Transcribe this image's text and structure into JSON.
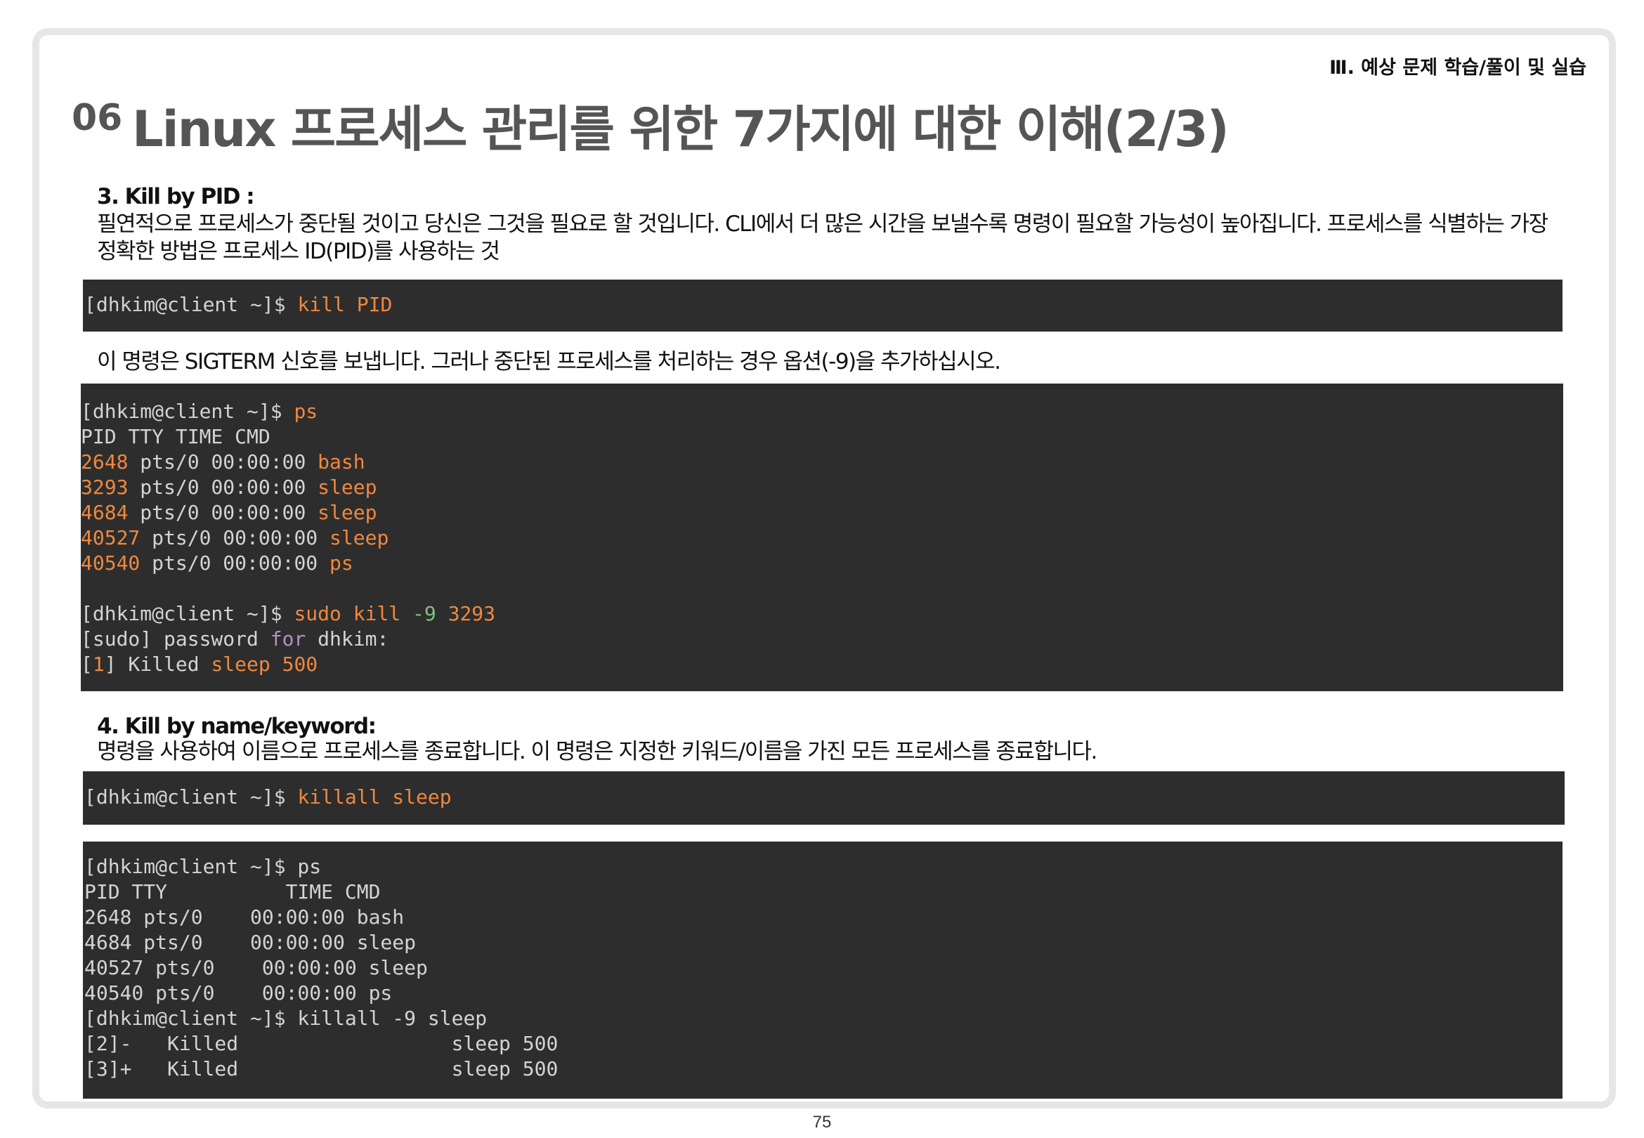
{
  "header": {
    "section_label": "Ⅲ. 예상 문제 학습/풀이 및 실습",
    "title_number": "06",
    "title": "Linux 프로세스 관리를 위한 7가지에 대한 이해(2/3)"
  },
  "kill_by_pid": {
    "heading": "3. Kill by PID :",
    "description": "필연적으로 프로세스가 중단될 것이고 당신은 그것을 필요로 할 것입니다. CLI에서 더 많은 시간을 보낼수록 명령이 필요할 가능성이 높아집니다. 프로세스를 식별하는 가장 정확한 방법은 프로세스 ID(PID)를 사용하는 것",
    "terminal1": {
      "prompt": "[dhkim@client ~]$ ",
      "command": "kill PID"
    },
    "note": "이 명령은 SIGTERM 신호를 보냅니다. 그러나 중단된 프로세스를 처리하는 경우 옵션(-9)을 추가하십시오.",
    "terminal2": {
      "prompt": "[dhkim@client ~]$ ",
      "ps_command": "ps",
      "header": "PID TTY TIME CMD",
      "rows": [
        {
          "pid": "2648",
          "rest": " pts/0 00:00:00 ",
          "cmd": "bash"
        },
        {
          "pid": "3293",
          "rest": " pts/0 00:00:00 ",
          "cmd": "sleep"
        },
        {
          "pid": "4684",
          "rest": " pts/0 00:00:00 ",
          "cmd": "sleep"
        },
        {
          "pid": "40527",
          "rest": " pts/0 00:00:00 ",
          "cmd": "sleep"
        },
        {
          "pid": "40540",
          "rest": " pts/0 00:00:00 ",
          "cmd": "ps"
        }
      ],
      "kill_cmd": "sudo kill",
      "kill_flag": " -9",
      "kill_pid": " 3293",
      "sudo_prefix": "[sudo] password ",
      "sudo_for": "for",
      "sudo_user": " dhkim:",
      "killed_open": "[",
      "killed_num": "1",
      "killed_mid": "] Killed ",
      "killed_cmd": "sleep 500"
    }
  },
  "kill_by_name": {
    "heading": "4. Kill by name/keyword:",
    "description": "명령을 사용하여 이름으로 프로세스를 종료합니다. 이 명령은 지정한 키워드/이름을 가진 모든 프로세스를 종료합니다.",
    "terminal3": {
      "prompt": "[dhkim@client ~]$ ",
      "command": "killall sleep"
    },
    "terminal4": {
      "lines": [
        "[dhkim@client ~]$ ps",
        "PID TTY          TIME CMD",
        "2648 pts/0    00:00:00 bash",
        "4684 pts/0    00:00:00 sleep",
        "40527 pts/0    00:00:00 sleep",
        "40540 pts/0    00:00:00 ps",
        "[dhkim@client ~]$ killall -9 sleep",
        "[2]-   Killed                  sleep 500",
        "[3]+   Killed                  sleep 500"
      ]
    }
  },
  "footer": {
    "page_number": "75"
  },
  "colors": {
    "terminal_bg": "#2d2d2d",
    "terminal_text": "#d4d4d4",
    "accent_orange": "#f0883e",
    "accent_green": "#7ec27e",
    "accent_purple": "#b88ec9",
    "title_gray": "#555555"
  }
}
